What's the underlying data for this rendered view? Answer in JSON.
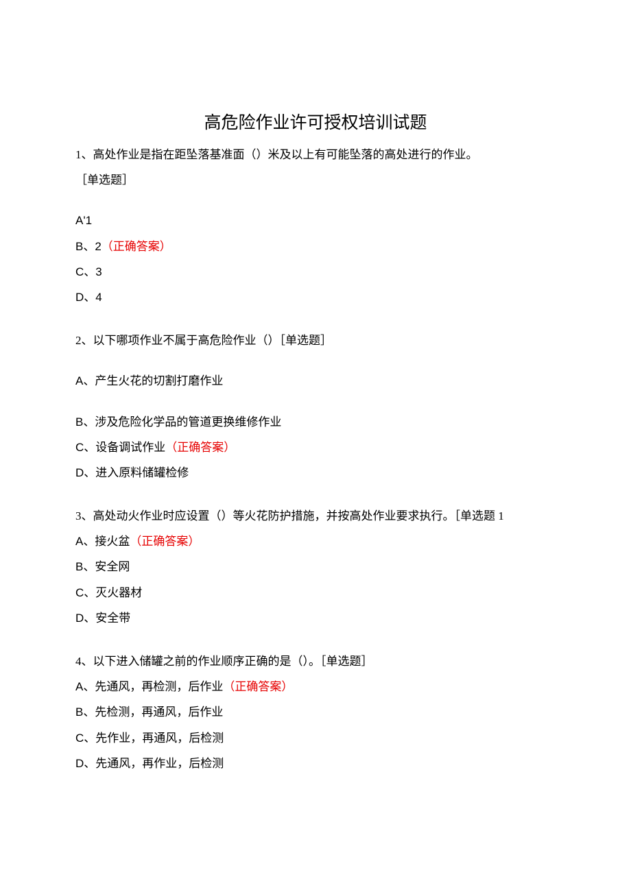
{
  "title": "高危险作业许可授权培训试题",
  "questions": [
    {
      "stem": "1、高处作业是指在距坠落基准面（）米及以上有可能坠落的高处进行的作业。",
      "type_label": "［单选题］",
      "options": [
        {
          "label": "A'1",
          "correct": false,
          "sans": true
        },
        {
          "label": "B、2",
          "correct": true,
          "sans": true
        },
        {
          "label": "C、3",
          "correct": false,
          "sans": true
        },
        {
          "label": "D、4",
          "correct": false,
          "sans": true
        }
      ]
    },
    {
      "stem": "2、以下哪项作业不属于高危险作业（）［单选题］",
      "options": [
        {
          "prefix": "A、",
          "text": "产生火花的切割打磨作业",
          "correct": false
        },
        {
          "prefix": "B、",
          "text": "涉及危险化学品的管道更换维修作业",
          "correct": false
        },
        {
          "prefix": "C、",
          "text": "设备调试作业",
          "correct": true
        },
        {
          "prefix": "D、",
          "text": "进入原料储罐检修",
          "correct": false
        }
      ]
    },
    {
      "stem": "3、高处动火作业时应设置（）等火花防护措施，并按高处作业要求执行。［单选题 1",
      "options": [
        {
          "prefix": "A、",
          "text": "接火盆",
          "correct": true
        },
        {
          "prefix": "B、",
          "text": "安全网",
          "correct": false
        },
        {
          "prefix": "C、",
          "text": "灭火器材",
          "correct": false
        },
        {
          "prefix": "D、",
          "text": "安全带",
          "correct": false
        }
      ]
    },
    {
      "stem": "4、以下进入储罐之前的作业顺序正确的是（）。［单选题］",
      "options": [
        {
          "prefix": "A、",
          "text": "先通风，再检测，后作业",
          "correct": true
        },
        {
          "prefix": "B、",
          "text": "先检测，再通风，后作业",
          "correct": false
        },
        {
          "prefix": "C、",
          "text": "先作业，再通风，后检测",
          "correct": false
        },
        {
          "prefix": "D、",
          "text": "先通风，再作业，后检测",
          "correct": false
        }
      ]
    }
  ],
  "correct_suffix": "（正确答案）"
}
